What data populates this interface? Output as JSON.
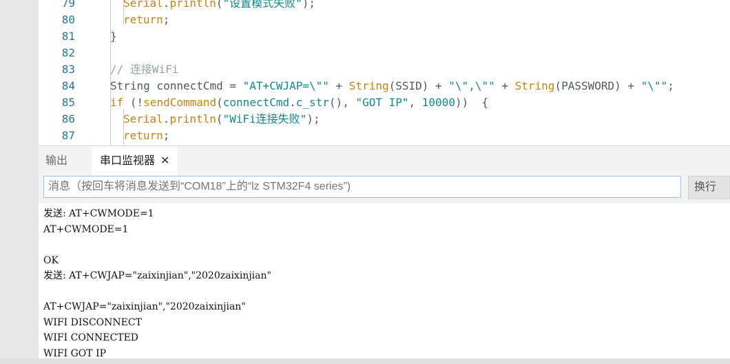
{
  "editor": {
    "lines": [
      {
        "num": "79",
        "indent": 2,
        "tokens": [
          [
            "fn",
            "Serial"
          ],
          [
            "",
            "."
          ],
          [
            "fn",
            "println"
          ],
          [
            "",
            "("
          ],
          [
            "str",
            "\"设置模式失败\""
          ],
          [
            "",
            ");"
          ]
        ]
      },
      {
        "num": "80",
        "indent": 2,
        "tokens": [
          [
            "kw",
            "return"
          ],
          [
            "",
            ";"
          ]
        ]
      },
      {
        "num": "81",
        "indent": 1,
        "tokens": [
          [
            "",
            "}"
          ]
        ]
      },
      {
        "num": "82",
        "indent": 1,
        "tokens": []
      },
      {
        "num": "83",
        "indent": 1,
        "tokens": [
          [
            "cm",
            "// 连接WiFi"
          ]
        ]
      },
      {
        "num": "84",
        "indent": 1,
        "tokens": [
          [
            "",
            "String connectCmd = "
          ],
          [
            "str",
            "\"AT+CWJAP=\\\"\""
          ],
          [
            "",
            " + "
          ],
          [
            "type",
            "String"
          ],
          [
            "",
            "(SSID) + "
          ],
          [
            "str",
            "\"\\\",\\\"\""
          ],
          [
            "",
            " + "
          ],
          [
            "type",
            "String"
          ],
          [
            "",
            "(PASSWORD) + "
          ],
          [
            "str",
            "\"\\\"\""
          ],
          [
            "",
            ";"
          ]
        ]
      },
      {
        "num": "85",
        "indent": 1,
        "tokens": [
          [
            "kw",
            "if"
          ],
          [
            "",
            " (!"
          ],
          [
            "fn",
            "sendCommand"
          ],
          [
            "",
            "("
          ],
          [
            "teal",
            "connectCmd"
          ],
          [
            "",
            "."
          ],
          [
            "teal",
            "c_str"
          ],
          [
            "",
            "(), "
          ],
          [
            "str",
            "\"GOT IP\""
          ],
          [
            "",
            ", "
          ],
          [
            "num",
            "10000"
          ],
          [
            "",
            "))  {"
          ]
        ]
      },
      {
        "num": "86",
        "indent": 2,
        "tokens": [
          [
            "fn",
            "Serial"
          ],
          [
            "",
            "."
          ],
          [
            "fn",
            "println"
          ],
          [
            "",
            "("
          ],
          [
            "str",
            "\"WiFi连接失败\""
          ],
          [
            "",
            ");"
          ]
        ]
      },
      {
        "num": "87",
        "indent": 2,
        "tokens": [
          [
            "kw",
            "return"
          ],
          [
            "",
            ";"
          ]
        ]
      }
    ]
  },
  "tabs": {
    "output_label": "输出",
    "serial_label": "串口监视器",
    "close_glyph": "✕"
  },
  "message": {
    "placeholder": "消息（按回车将消息发送到“COM18”上的“lz STM32F4 series”)",
    "line_ending_label": "换行"
  },
  "monitor": {
    "lines": [
      "发送: AT+CWMODE=1",
      "AT+CWMODE=1",
      "",
      "OK",
      "发送: AT+CWJAP=\"zaixinjian\",\"2020zaixinjian\"",
      "",
      "AT+CWJAP=\"zaixinjian\",\"2020zaixinjian\"",
      "WIFI DISCONNECT",
      "WIFI CONNECTED",
      "WIFI GOT IP"
    ]
  }
}
